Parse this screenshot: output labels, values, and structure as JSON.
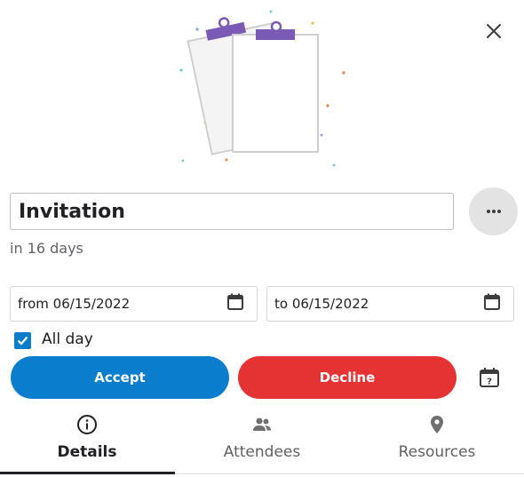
{
  "event": {
    "title": "Invitation",
    "relative_time": "in 16 days"
  },
  "dates": {
    "from": "from 06/15/2022",
    "to": "to 06/15/2022"
  },
  "all_day": {
    "label": "All day",
    "checked": true
  },
  "actions": {
    "accept": "Accept",
    "decline": "Decline"
  },
  "tabs": [
    {
      "label": "Details",
      "icon": "info-icon",
      "active": true
    },
    {
      "label": "Attendees",
      "icon": "people-icon",
      "active": false
    },
    {
      "label": "Resources",
      "icon": "location-pin-icon",
      "active": false
    }
  ],
  "icons": {
    "close": "close-icon",
    "more": "more-horizontal-icon",
    "calendar": "calendar-icon",
    "calendar_help": "calendar-question-icon",
    "checkbox": "checkmark-icon"
  },
  "colors": {
    "accept": "#0a7dcc",
    "decline": "#e53232",
    "checkbox": "#0a7cc9",
    "clip": "#7b5ab5"
  }
}
